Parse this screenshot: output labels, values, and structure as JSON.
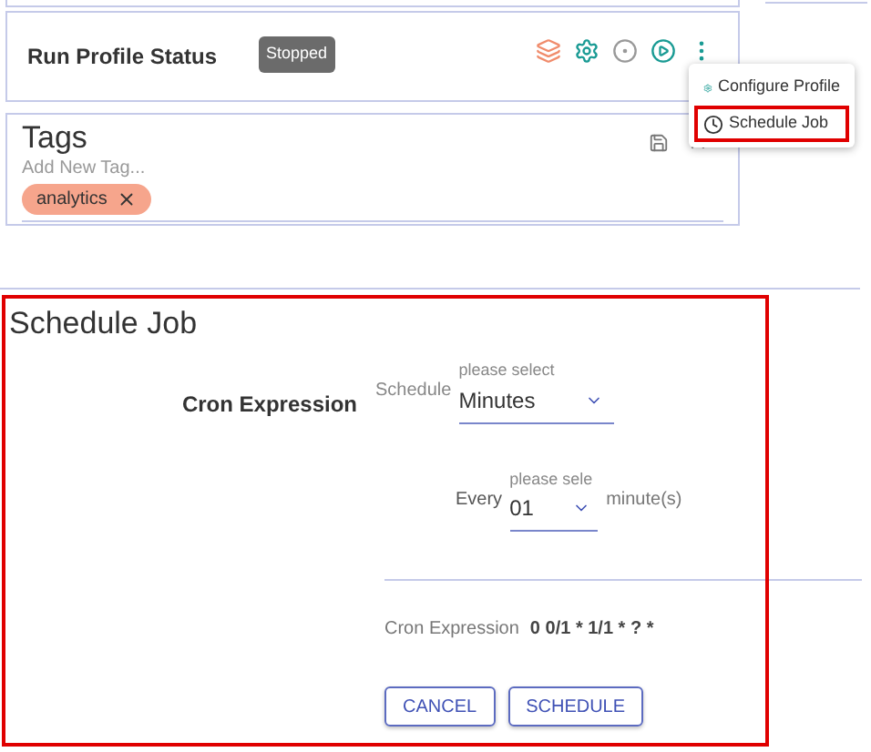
{
  "profile_card": {
    "label": "Run Profile Status",
    "status": "Stopped"
  },
  "menu": {
    "items": [
      {
        "kind": "gear",
        "label": "Configure Profile",
        "highlighted": false
      },
      {
        "kind": "clock",
        "label": "Schedule Job",
        "highlighted": true
      }
    ]
  },
  "tags": {
    "title": "Tags",
    "placeholder": "Add New Tag...",
    "chips": [
      {
        "label": "analytics"
      }
    ]
  },
  "schedule_job": {
    "title": "Schedule Job",
    "highlighted": true,
    "section_label": "Cron Expression",
    "schedule": {
      "label": "Schedule",
      "hint": "please select",
      "value": "Minutes"
    },
    "every": {
      "label": "Every",
      "hint": "please sele",
      "value": "01",
      "unit": "minute(s)"
    },
    "result": {
      "label": "Cron Expression",
      "value": "0 0/1 * 1/1 * ? *"
    },
    "buttons": [
      "CANCEL",
      "SCHEDULE"
    ]
  }
}
